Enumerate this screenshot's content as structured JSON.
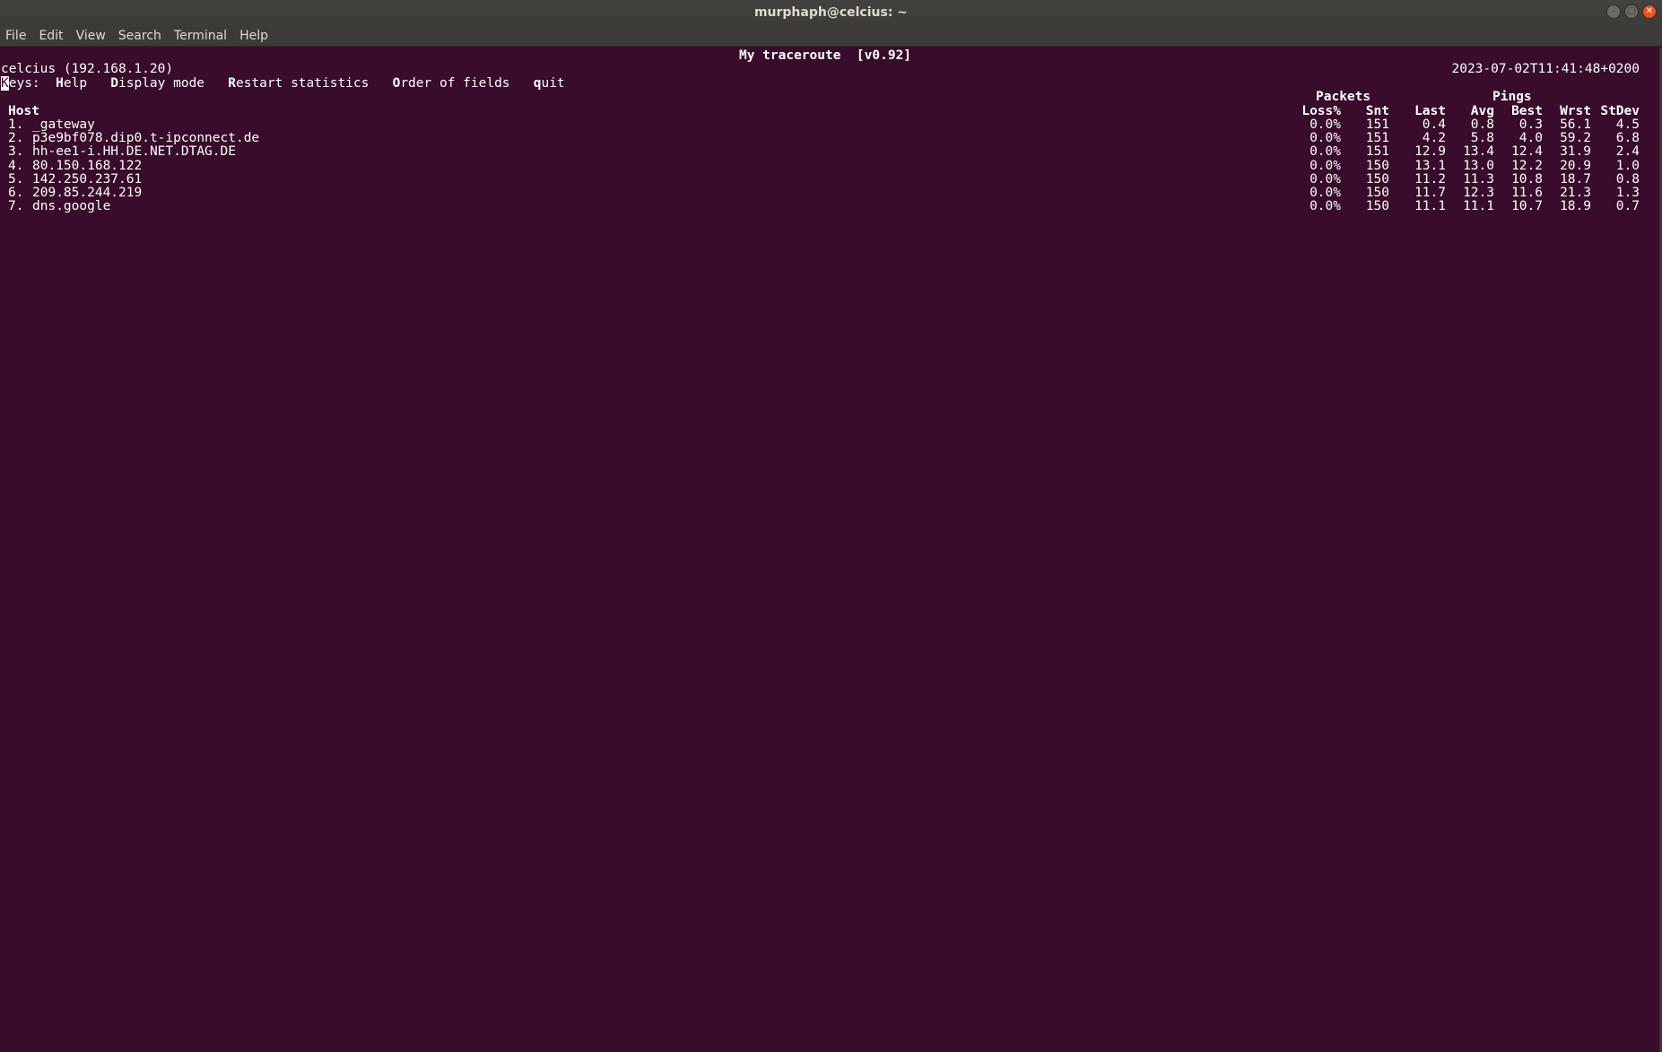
{
  "window": {
    "title": "murphaph@celcius: ~",
    "controls": [
      "minimize-icon",
      "maximize-icon",
      "close-icon"
    ]
  },
  "menubar": {
    "items": [
      "File",
      "Edit",
      "View",
      "Search",
      "Terminal",
      "Help"
    ]
  },
  "mtr": {
    "program_title": "My traceroute  [v0.92]",
    "local_host": "celcius (192.168.1.20)",
    "timestamp": "2023-07-02T11:41:48+0200",
    "keys": {
      "prefix_cursor": "K",
      "prefix_rest": "eys:",
      "items": [
        {
          "hotkey": "H",
          "rest": "elp"
        },
        {
          "hotkey": "D",
          "rest": "isplay mode"
        },
        {
          "hotkey": "R",
          "rest": "estart statistics"
        },
        {
          "hotkey": "O",
          "rest": "rder of fields"
        },
        {
          "hotkey": "q",
          "rest": "uit"
        }
      ]
    },
    "group_headers": {
      "packets": "Packets",
      "pings": "Pings"
    },
    "columns": {
      "host": "Host",
      "loss": "Loss%",
      "snt": "Snt",
      "last": "Last",
      "avg": "Avg",
      "best": "Best",
      "wrst": "Wrst",
      "stdev": "StDev"
    },
    "hops": [
      {
        "num": "1.",
        "host": "_gateway",
        "loss": "0.0%",
        "snt": "151",
        "last": "0.4",
        "avg": "0.8",
        "best": "0.3",
        "wrst": "56.1",
        "stdev": "4.5"
      },
      {
        "num": "2.",
        "host": "p3e9bf078.dip0.t-ipconnect.de",
        "loss": "0.0%",
        "snt": "151",
        "last": "4.2",
        "avg": "5.8",
        "best": "4.0",
        "wrst": "59.2",
        "stdev": "6.8"
      },
      {
        "num": "3.",
        "host": "hh-ee1-i.HH.DE.NET.DTAG.DE",
        "loss": "0.0%",
        "snt": "151",
        "last": "12.9",
        "avg": "13.4",
        "best": "12.4",
        "wrst": "31.9",
        "stdev": "2.4"
      },
      {
        "num": "4.",
        "host": "80.150.168.122",
        "loss": "0.0%",
        "snt": "150",
        "last": "13.1",
        "avg": "13.0",
        "best": "12.2",
        "wrst": "20.9",
        "stdev": "1.0"
      },
      {
        "num": "5.",
        "host": "142.250.237.61",
        "loss": "0.0%",
        "snt": "150",
        "last": "11.2",
        "avg": "11.3",
        "best": "10.8",
        "wrst": "18.7",
        "stdev": "0.8"
      },
      {
        "num": "6.",
        "host": "209.85.244.219",
        "loss": "0.0%",
        "snt": "150",
        "last": "11.7",
        "avg": "12.3",
        "best": "11.6",
        "wrst": "21.3",
        "stdev": "1.3"
      },
      {
        "num": "7.",
        "host": "dns.google",
        "loss": "0.0%",
        "snt": "150",
        "last": "11.1",
        "avg": "11.1",
        "best": "10.7",
        "wrst": "18.9",
        "stdev": "0.7"
      }
    ]
  }
}
